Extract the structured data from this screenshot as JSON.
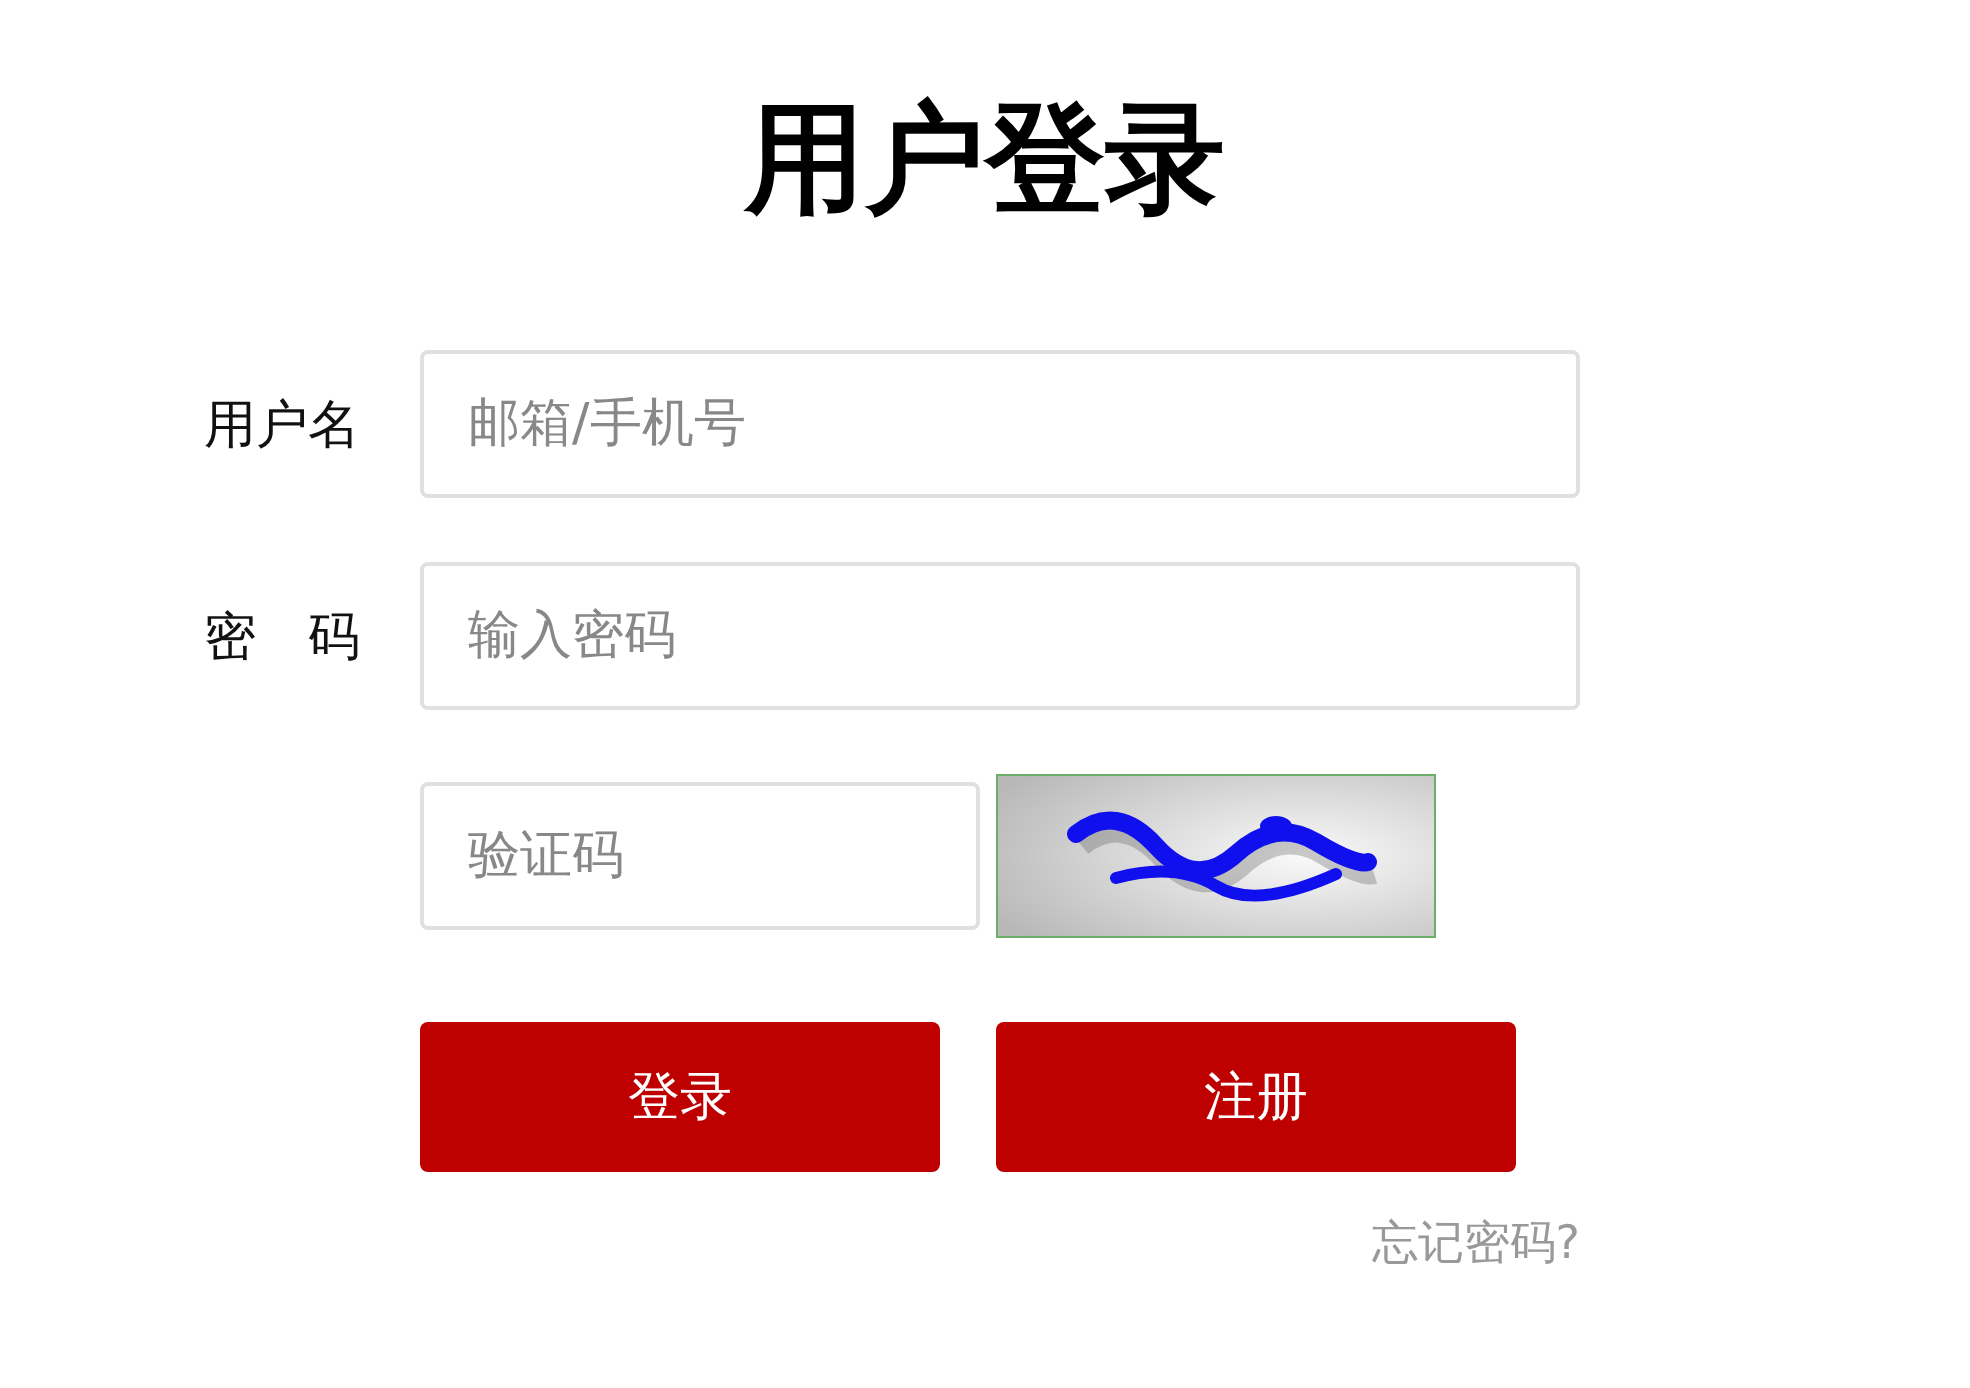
{
  "title": "用户登录",
  "fields": [
    {
      "label": "用户名",
      "placeholder": "邮箱/手机号"
    },
    {
      "label": "密　码",
      "placeholder": "输入密码"
    }
  ],
  "captcha": {
    "placeholder": "验证码"
  },
  "buttons": [
    "登录",
    "注册"
  ],
  "forgot_link": "忘记密码?"
}
